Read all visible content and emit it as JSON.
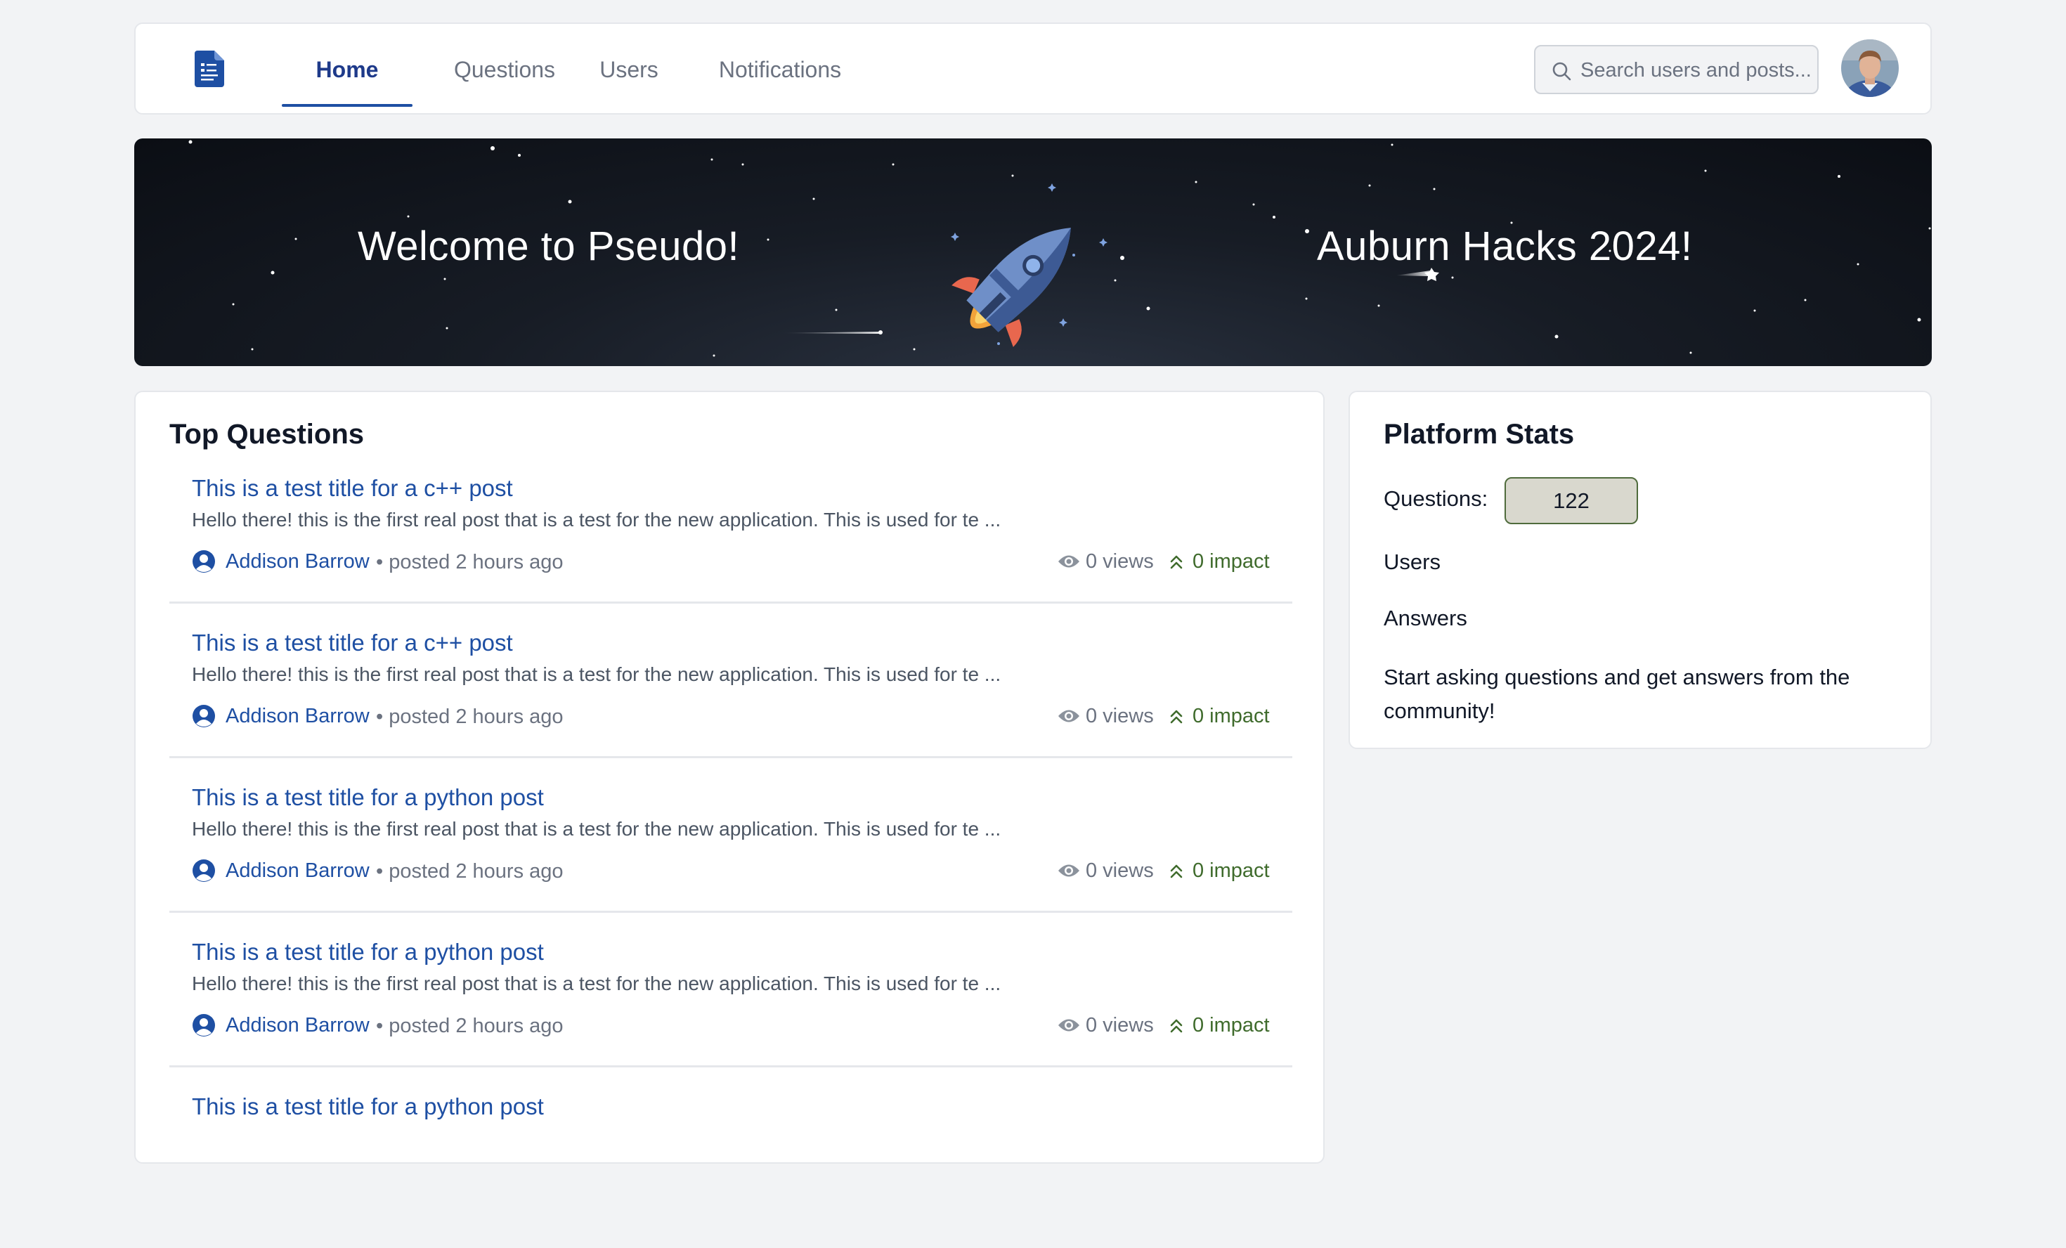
{
  "nav": {
    "tabs": [
      {
        "label": "Home",
        "active": true
      },
      {
        "label": "Questions",
        "active": false
      },
      {
        "label": "Users",
        "active": false
      },
      {
        "label": "Notifications",
        "active": false
      }
    ],
    "search_placeholder": "Search users and posts...",
    "logo_icon": "document-icon",
    "avatar_icon": "user-avatar"
  },
  "banner": {
    "left_text": "Welcome to Pseudo!",
    "right_text": "Auburn Hacks 2024!",
    "art_icon": "rocket-icon"
  },
  "top_questions": {
    "title": "Top Questions",
    "items": [
      {
        "title": "This is a test title for a c++ post",
        "excerpt": "Hello there! this is the first real post that is a test for the new application. This is used for te ...",
        "author": "Addison Barrow",
        "posted": "• posted 2 hours ago",
        "views": "0 views",
        "impact": "0 impact"
      },
      {
        "title": "This is a test title for a c++ post",
        "excerpt": "Hello there! this is the first real post that is a test for the new application. This is used for te ...",
        "author": "Addison Barrow",
        "posted": "• posted 2 hours ago",
        "views": "0 views",
        "impact": "0 impact"
      },
      {
        "title": "This is a test title for a python post",
        "excerpt": "Hello there! this is the first real post that is a test for the new application. This is used for te ...",
        "author": "Addison Barrow",
        "posted": "• posted 2 hours ago",
        "views": "0 views",
        "impact": "0 impact"
      },
      {
        "title": "This is a test title for a python post",
        "excerpt": "Hello there! this is the first real post that is a test for the new application. This is used for te ...",
        "author": "Addison Barrow",
        "posted": "• posted 2 hours ago",
        "views": "0 views",
        "impact": "0 impact"
      },
      {
        "title": "This is a test title for a python post"
      }
    ]
  },
  "platform_stats": {
    "title": "Platform Stats",
    "questions_label": "Questions:",
    "questions_value": "122",
    "users_label": "Users",
    "answers_label": "Answers",
    "cta": "Start asking questions and get answers from the community!"
  },
  "colors": {
    "accent": "#1e4fa3",
    "impact": "#3f6b2c",
    "badge_bg": "#d9d8ce",
    "badge_border": "#4f6b3c"
  }
}
